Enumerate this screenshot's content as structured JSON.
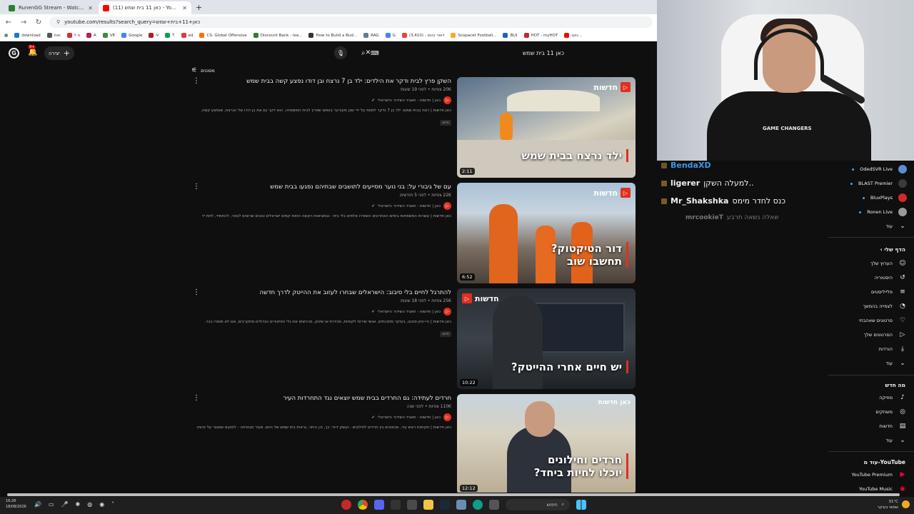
{
  "browser": {
    "tabs": [
      {
        "title": "RunenGG Stream - Watch Live",
        "color": "#2e7d32",
        "active": false
      },
      {
        "title": "(11) כאן 11 בית שמש - YouTube",
        "color": "#ff0000",
        "active": true
      }
    ],
    "new_tab": "+",
    "url": "youtube.com/results?search_query=כאן+11+בית+שמש",
    "bookmarks": [
      "download",
      "ואח",
      "ט ל",
      "A",
      "VE",
      "Google",
      "V",
      "T",
      "ed",
      "CS: Global Offensive",
      "Discount Bank - lea...",
      "How to Build a Bud...",
      "RAG",
      "G",
      "(3,410) - דואר נכנס",
      "Scopacet Football...",
      "BLII",
      "HOT - myHOT",
      "נוענ..."
    ]
  },
  "youtube": {
    "avatar_letter": "G",
    "notifications": "9+",
    "create_label": "יצירה",
    "search_query": "כאן 11 בית שמש",
    "filters_label": "מסננים",
    "results": [
      {
        "title": "השקן פרץ לבית ודקר את הילדים: ילד בן 7 נרצח ובן דודו נפצע קשה בבית שמש",
        "stats": "20K צפיות • לפני 19 שעות",
        "channel": "כאן | חדשות - תאגיד השידור הישראלי",
        "desc": "כאן חדשות | רצח בבית שמש: ילד בן 7 נדקר למוות על ידי שכן מעורער בנפשו שפרץ לבית המשפחה. הוא דקר גם את בן דודו של הנרצח, שנפצע קשה.",
        "badge": "חדש",
        "duration": "2:11",
        "caption": "ילד נרצח בבית שמש",
        "brand": "חדשות"
      },
      {
        "title": "עם של גיבורי על: בני נוער מסייעים לתושבים שבתיהם נפגעו בבית שמש",
        "stats": "22K צפיות • לפני 5 חודשים",
        "channel": "כאן | חדשות - תאגיד השידור הישראלי",
        "desc": "כאן חדשות | עשרות המשפחות בימים האחרונים השאירו אלפים בלי בית - ובמציאות הקשה הזאת קמים ישראלים טובים שרוצים לעזור, להתמיד, לתת יד",
        "badge": "",
        "duration": "6:52",
        "caption": "דור הטיקטוק? תחשבו שוב",
        "brand": "חדשות"
      },
      {
        "title": "להתרגל לחיים בלי סיבוב: הישראלים שבחרו לעזוב את ההייטק לדרך חדשה",
        "stats": "25K צפיות • לפני 18 שעות",
        "channel": "כאן | חדשות - תאגיד השידור הישראלי",
        "desc": "כאן חדשות | היי-טק-סיבוב, בעיקר מתכנתים, אנשי שירות לקוחות, מכירות או שיווק, מרגישים את גלי הפיטורים הגדולים מתקרבים, אם לא מוסרו כבר.",
        "badge": "חדש",
        "duration": "10:22",
        "caption": "יש חיים אחרי ההייטק?",
        "brand": "חדשות"
      },
      {
        "title": "חרדים לעתידה: גם החרדים בבית שמש יוצאים נגד התחרדות העיר",
        "stats": "110K צפיות • לפני שנה",
        "channel": "כאן | חדשות - תאגיד השידור הישראלי",
        "desc": "כאן חדשות | תקיפות ראש עיר, סכסוכים בין חרדים לחילונים - ועשק דיור: כך, בין היתר, נראית בית שמש של היום. מעיר מבטיחה - למקום שנסגר על זהותו",
        "badge": "",
        "duration": "12:12",
        "caption": "חרדים וחילונים יוכלו לחיות ביחד?",
        "brand": "כאן חדשות"
      }
    ]
  },
  "webcam": {
    "shirt_text": "GAME CHANGERS"
  },
  "chat": [
    {
      "user": "BendaXD",
      "message": "",
      "color": "#3ea6ff"
    },
    {
      "user": "ligerer",
      "message": "..למעלה השקן",
      "color": "#ffffff"
    },
    {
      "user": "Mr_Shakshka",
      "message": "כנס לחדר מימס",
      "color": "#ffffff"
    },
    {
      "user": "mrcookieT",
      "message": "שאלה נשאה תרבע",
      "color": "#777777"
    }
  ],
  "sidebar": {
    "subscriptions": [
      {
        "name": "OdedSVR Live",
        "color": "#5b8dd6"
      },
      {
        "name": "BLAST Premier",
        "color": "#3a3a3a"
      },
      {
        "name": "BluxPlays",
        "color": "#d12a2a"
      },
      {
        "name": "Ronen Live",
        "color": "#9a9a9a"
      }
    ],
    "more_1": "עוד",
    "you_header": "הדף שלי",
    "you_items": [
      {
        "label": "הערוץ שלך",
        "icon": "channel-icon",
        "glyph": "☺"
      },
      {
        "label": "היסטוריה",
        "icon": "history-icon",
        "glyph": "↺"
      },
      {
        "label": "פלייליסטים",
        "icon": "playlist-icon",
        "glyph": "≡"
      },
      {
        "label": "לצפייה בהמשך",
        "icon": "clock-icon",
        "glyph": "◔"
      },
      {
        "label": "סרטונים שאהבתי",
        "icon": "like-icon",
        "glyph": "👍"
      },
      {
        "label": "הסרטונים שלך",
        "icon": "video-icon",
        "glyph": "▷"
      },
      {
        "label": "הורדות",
        "icon": "download-icon",
        "glyph": "⤓"
      }
    ],
    "more_2": "עוד",
    "explore_header": "מה חדש",
    "explore_items": [
      {
        "label": "מוזיקה",
        "icon": "music-icon",
        "glyph": "♪"
      },
      {
        "label": "משחקים",
        "icon": "gaming-icon",
        "glyph": "◎"
      },
      {
        "label": "חדשות",
        "icon": "news-icon",
        "glyph": "▤"
      }
    ],
    "more_3": "עוד",
    "more_from_header": "עוד מ-YouTube",
    "products": [
      {
        "label": "YouTube Premium"
      },
      {
        "label": "YouTube Music"
      }
    ]
  },
  "taskbar": {
    "time": "16:26",
    "date": "18/08/2026",
    "search_placeholder": "חיפוש",
    "weather": "31°C",
    "weather_desc": "שמשי בעיקר"
  }
}
